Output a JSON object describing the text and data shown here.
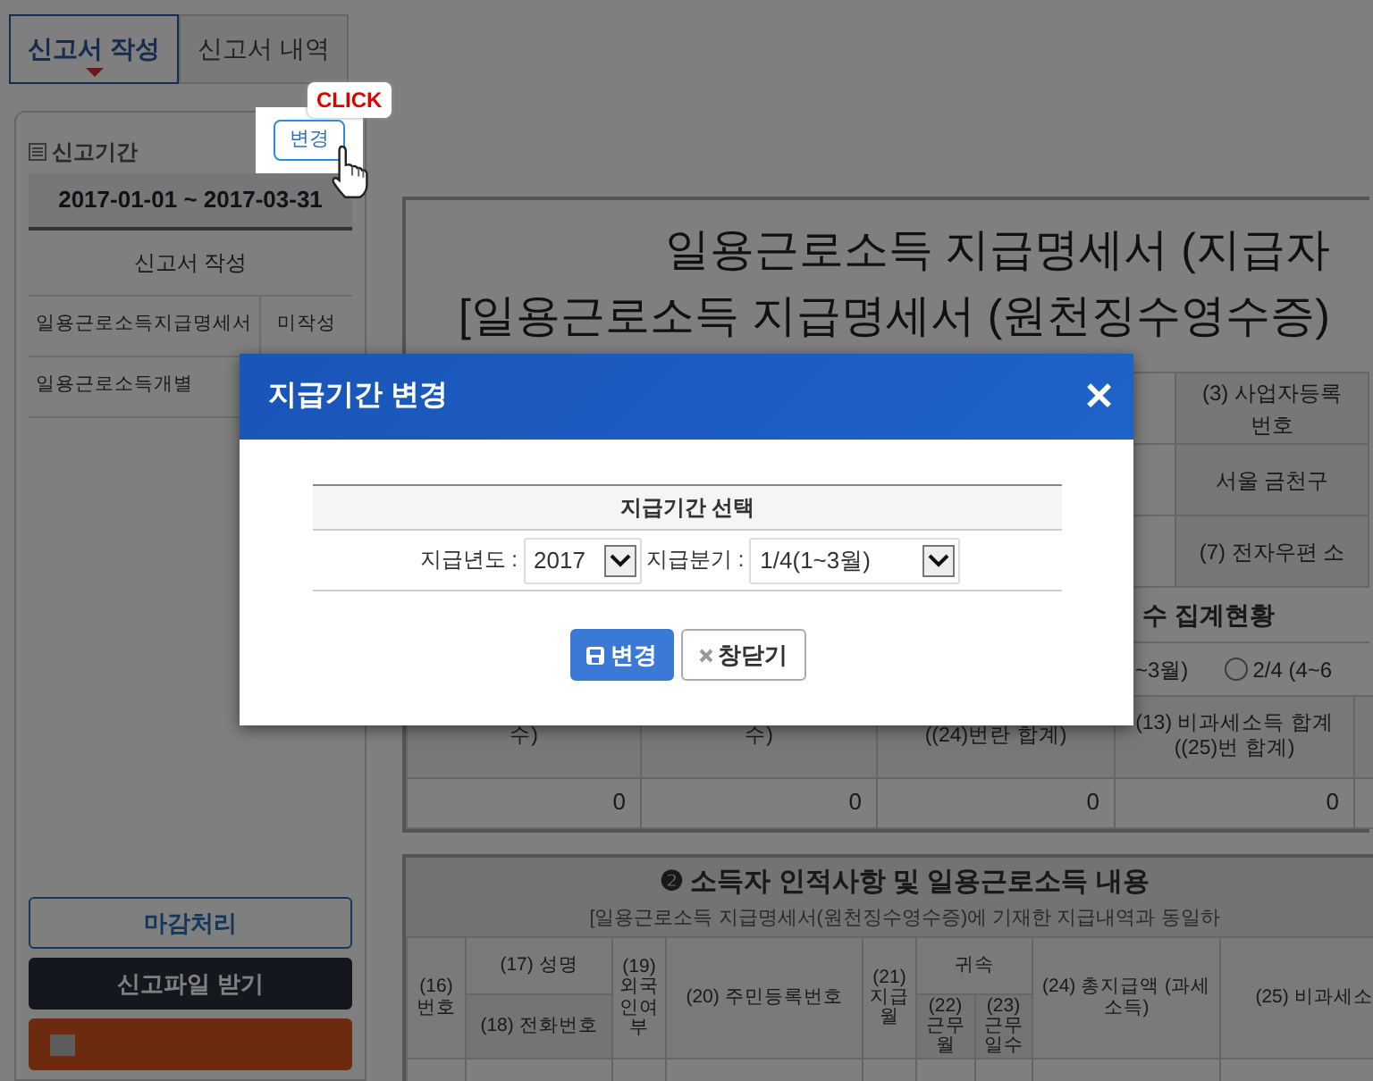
{
  "tabs": [
    {
      "label": "신고서 작성",
      "selected": true
    },
    {
      "label": "신고서 내역",
      "selected": false
    }
  ],
  "sidebar": {
    "period_label": "신고기간",
    "change_button": "변경",
    "click_callout": "CLICK",
    "period": "2017-01-01 ~ 2017-03-31",
    "report_table": {
      "header": "신고서 작성",
      "rows": [
        {
          "name": "일용근로소득지급명세서",
          "status": "미작성"
        },
        {
          "name": "일용근로소득개별"
        }
      ]
    },
    "buttons": [
      {
        "label": "마감처리",
        "kind": "outline"
      },
      {
        "label": "신고파일 받기",
        "kind": "dark"
      },
      {
        "kind": "orange"
      }
    ]
  },
  "document": {
    "title_lines": [
      "일용근로소득 지급명세서 (지급자",
      "[일용근로소득 지급명세서 (원천징수영수증)"
    ],
    "info_cells": [
      "(3) 사업자등록 번호",
      "서울 금천구",
      "(7) 전자우편 소"
    ],
    "summary": {
      "heading": "수 집계현황",
      "period_fragment": "~3월)",
      "quarter_options": [
        {
          "label": "2/4 (4~6",
          "selected": false
        }
      ],
      "columns": [
        "수)",
        "수)",
        "((24)번란 합계)",
        "(13) 비과세소득 합계 ((25)번 합계)"
      ],
      "values": [
        "0",
        "0",
        "0",
        "0"
      ]
    },
    "section2": {
      "number": "❷",
      "title": "소득자 인적사항 및 일용근로소득 내용",
      "subtitle": "[일용근로소득 지급명세서(원천징수영수증)에 기재한 지급내역과 동일하",
      "columns": [
        {
          "label": "(16) 번호"
        },
        {
          "label": "(17) 성명",
          "sub_label": "(18) 전화번호"
        },
        {
          "label": "(19) 외국인여부"
        },
        {
          "label": "(20) 주민등록번호"
        },
        {
          "label": "(21) 지급월"
        },
        {
          "label": "귀속",
          "children": [
            {
              "label": "(22) 근무월"
            },
            {
              "label": "(23) 근무일수"
            }
          ]
        },
        {
          "label": "(24) 총지급액 (과세소득)"
        },
        {
          "label": "(25) 비과세소"
        }
      ]
    }
  },
  "dialog": {
    "title": "지급기간 변경",
    "close": "✕",
    "table_header": "지급기간 선택",
    "fields": [
      {
        "label": "지급년도 :",
        "value": "2017"
      },
      {
        "label": "지급분기 :",
        "value": "1/4(1~3월)"
      }
    ],
    "buttons": [
      {
        "label": "변경",
        "kind": "primary"
      },
      {
        "label": "창닫기",
        "kind": "close"
      }
    ]
  }
}
